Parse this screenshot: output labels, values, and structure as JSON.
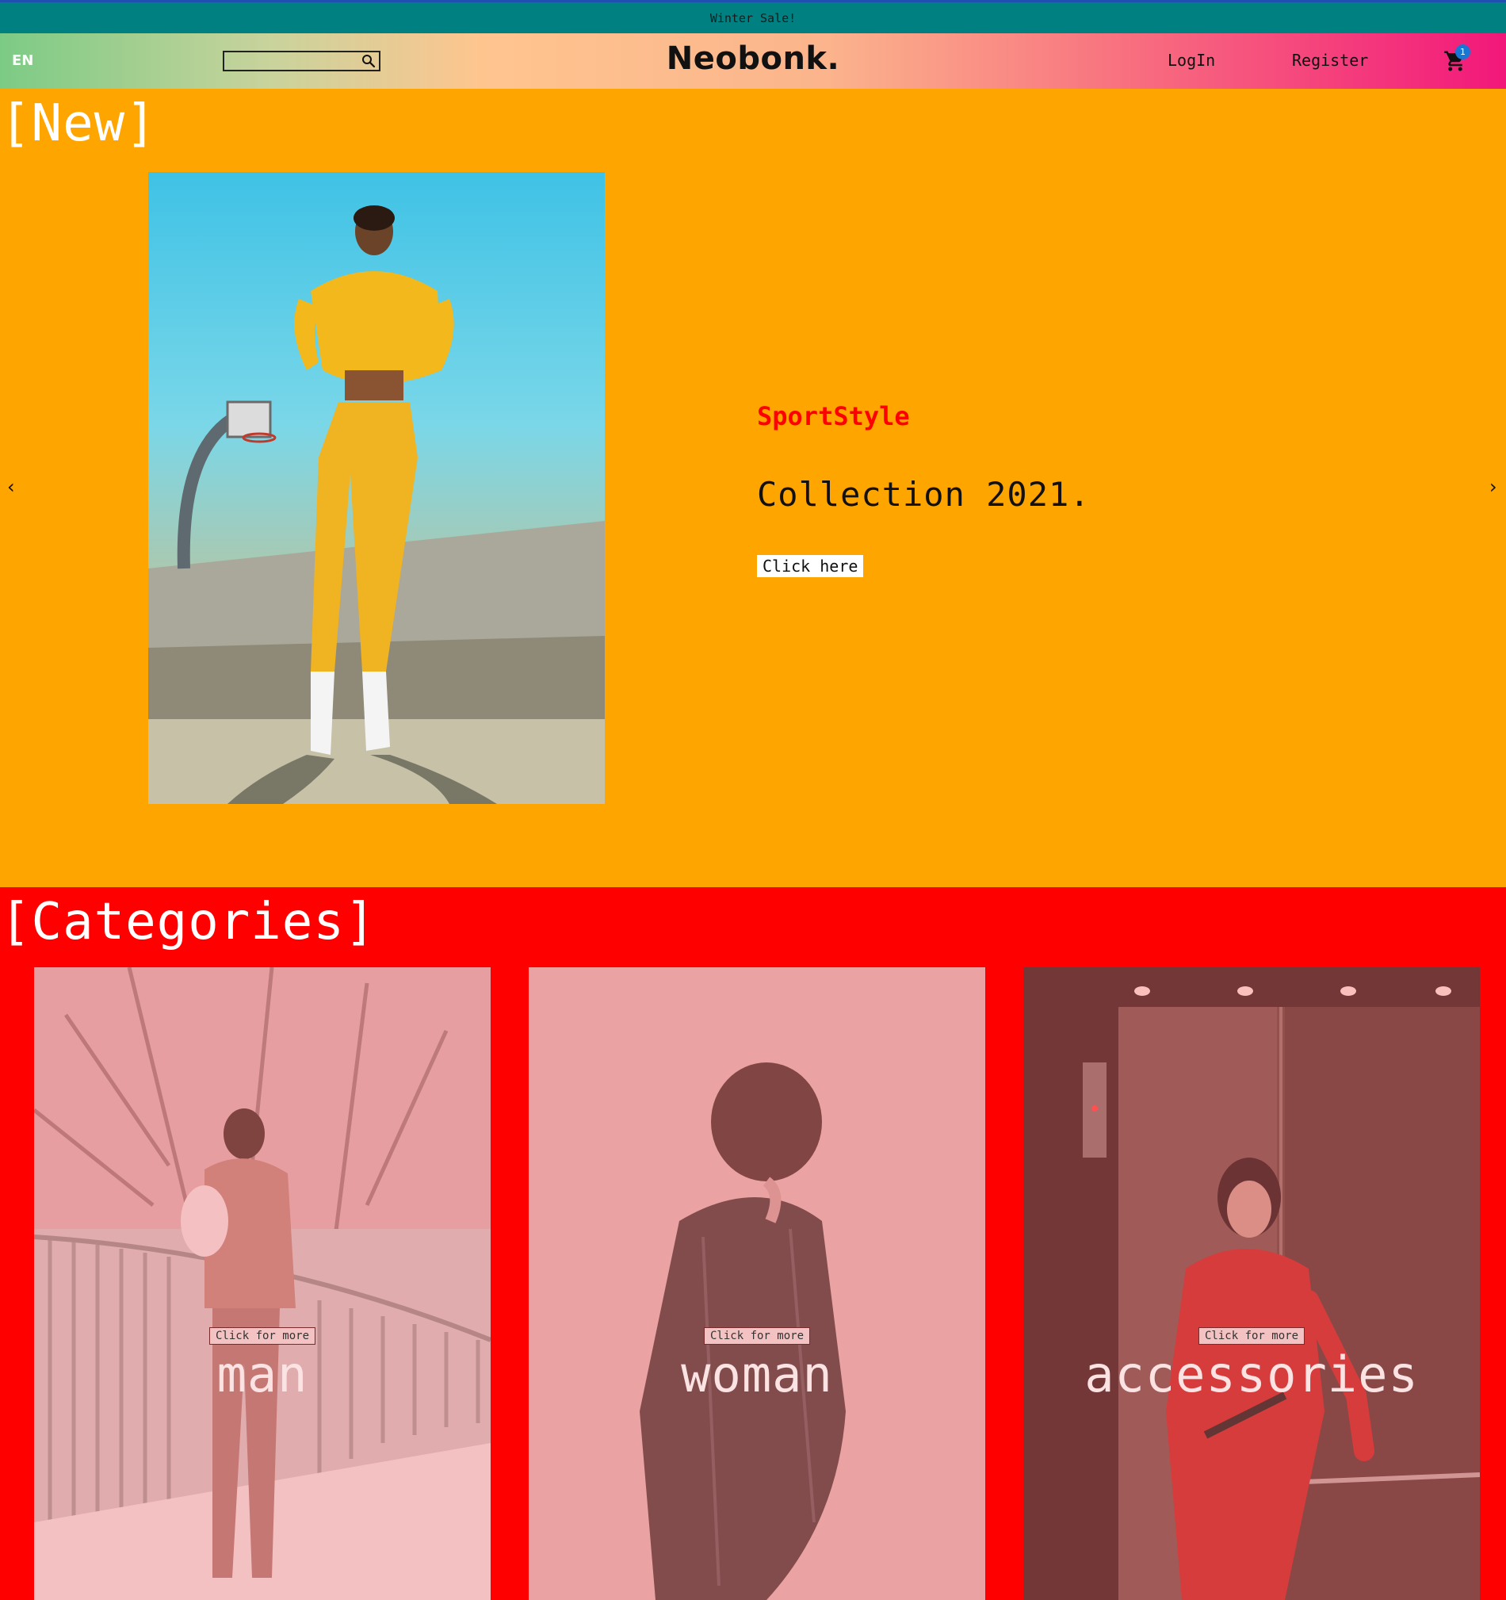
{
  "announcement": {
    "text": "Winter Sale!"
  },
  "navbar": {
    "language": "EN",
    "search": {
      "value": "",
      "placeholder": ""
    },
    "logo": "Neobonk.",
    "login_label": "LogIn",
    "register_label": "Register",
    "cart_count": "1"
  },
  "new_section": {
    "title": "[New]",
    "slide": {
      "subtitle": "SportStyle",
      "title": "Collection 2021.",
      "button_label": "Click here"
    },
    "prev_arrow": "‹",
    "next_arrow": "›"
  },
  "categories": {
    "title": "[Categories]",
    "items": [
      {
        "label": "man",
        "button_label": "Click for more"
      },
      {
        "label": "woman",
        "button_label": "Click for more"
      },
      {
        "label": "accessories",
        "button_label": "Click for more"
      }
    ]
  },
  "colors": {
    "announcement_bg": "#008080",
    "new_bg": "#ffa500",
    "categories_bg": "#ff0000",
    "accent": "#ff0000",
    "badge": "#1976d2"
  }
}
